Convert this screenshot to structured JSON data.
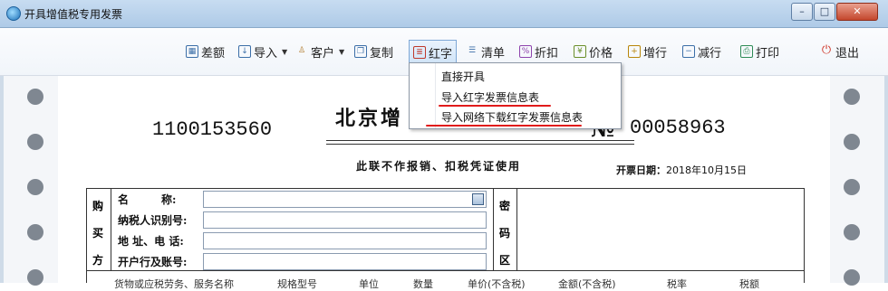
{
  "window": {
    "title": "开具增值税专用发票",
    "minimize": "–",
    "maximize": "□",
    "close": "✕"
  },
  "toolbar": [
    {
      "key": "diff",
      "label": "差额",
      "icon": "grid-icon"
    },
    {
      "key": "import",
      "label": "导入",
      "icon": "import-icon",
      "dropdown": true
    },
    {
      "key": "customer",
      "label": "客户",
      "icon": "user-icon",
      "dropdown": true
    },
    {
      "key": "copy",
      "label": "复制",
      "icon": "copy-icon"
    },
    {
      "key": "red",
      "label": "红字",
      "icon": "red-document-icon",
      "active": true
    },
    {
      "key": "list",
      "label": "清单",
      "icon": "list-icon"
    },
    {
      "key": "discount",
      "label": "折扣",
      "icon": "discount-icon"
    },
    {
      "key": "price",
      "label": "价格",
      "icon": "price-icon"
    },
    {
      "key": "addrow",
      "label": "增行",
      "icon": "add-row-icon"
    },
    {
      "key": "delrow",
      "label": "减行",
      "icon": "remove-row-icon"
    },
    {
      "key": "print",
      "label": "打印",
      "icon": "printer-icon"
    },
    {
      "key": "exit",
      "label": "退出",
      "icon": "power-icon"
    }
  ],
  "menu": {
    "items": [
      "直接开具",
      "导入红字发票信息表",
      "导入网络下载红字发票信息表"
    ],
    "highlight_color": "#e11b1b"
  },
  "invoice": {
    "title_visible": "北京增",
    "code": "1100153560",
    "no_mark": "№",
    "number": "00058963",
    "notice": "此联不作报销、扣税凭证使用",
    "date_label": "开票日期：",
    "date_value": "2018年10月15日",
    "buyer_label": [
      "购",
      "买",
      "方"
    ],
    "fields": [
      "名　　　称:",
      "纳税人识别号:",
      "地 址、电 话:",
      "开户行及账号:"
    ],
    "code_area_label": [
      "密",
      "码",
      "区"
    ],
    "table_headers": [
      "货物或应税劳务、服务名称",
      "规格型号",
      "单位",
      "数量",
      "单价(不含税)",
      "金额(不含税)",
      "税率",
      "税额"
    ]
  }
}
